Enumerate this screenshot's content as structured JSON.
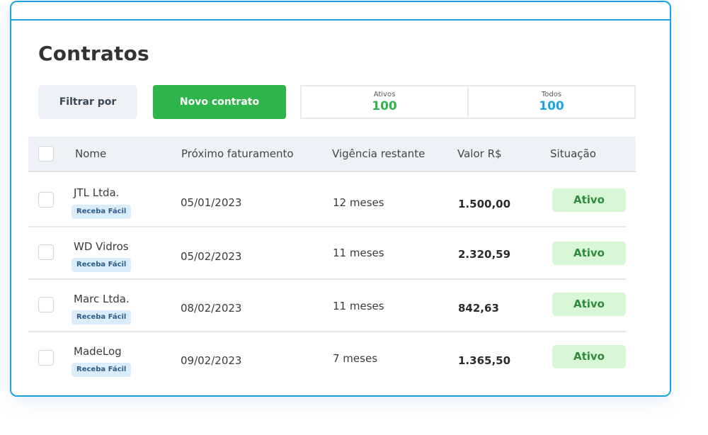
{
  "page": {
    "title": "Contratos"
  },
  "toolbar": {
    "filter_label": "Filtrar por",
    "new_label": "Novo contrato"
  },
  "counters": [
    {
      "label": "Ativos",
      "value": "100",
      "color": "#2eb44a"
    },
    {
      "label": "Todos",
      "value": "100",
      "color": "#1aa3e0"
    }
  ],
  "table": {
    "headers": [
      "Nome",
      "Próximo faturamento",
      "Vigência restante",
      "Valor R$",
      "Situação"
    ],
    "rows": [
      {
        "name": "JTL Ltda.",
        "tag": "Receba Fácil",
        "next_billing": "05/01/2023",
        "remaining": "12 meses",
        "value": "1.500,00",
        "status": "Ativo"
      },
      {
        "name": "WD Vidros",
        "tag": "Receba Fácil",
        "next_billing": "05/02/2023",
        "remaining": "11 meses",
        "value": "2.320,59",
        "status": "Ativo"
      },
      {
        "name": "Marc Ltda.",
        "tag": "Receba Fácil",
        "next_billing": "08/02/2023",
        "remaining": "11 meses",
        "value": "842,63",
        "status": "Ativo"
      },
      {
        "name": "MadeLog",
        "tag": "Receba Fácil",
        "next_billing": "09/02/2023",
        "remaining": "7 meses",
        "value": "1.365,50",
        "status": "Ativo"
      }
    ]
  },
  "colors": {
    "accent_blue": "#1aa3e0",
    "primary_green": "#2eb44a",
    "status_bg": "#d8f7d6",
    "tag_bg": "#dbecfb"
  }
}
